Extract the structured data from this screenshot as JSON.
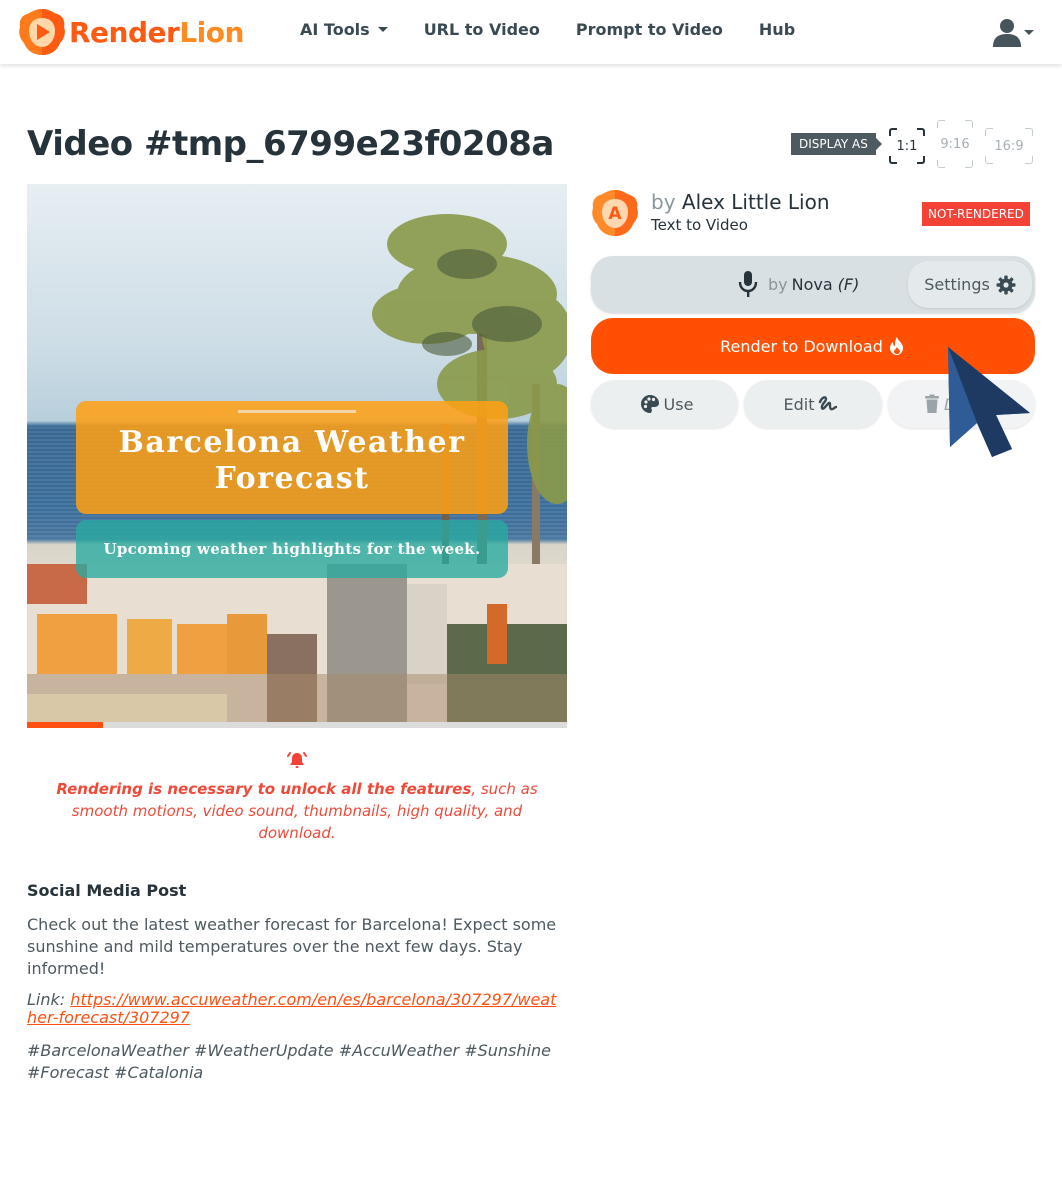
{
  "navbar": {
    "brand_part1": "Render",
    "brand_part2": "Lion",
    "items": [
      {
        "label": "AI Tools",
        "has_dropdown": true
      },
      {
        "label": "URL to Video"
      },
      {
        "label": "Prompt to Video"
      },
      {
        "label": "Hub"
      }
    ],
    "user_icon": "user-icon"
  },
  "page": {
    "title": "Video #tmp_6799e23f0208a",
    "display_as_label": "DISPLAY AS",
    "ratios": [
      {
        "label": "1:1",
        "active": true
      },
      {
        "label": "9:16",
        "active": false
      },
      {
        "label": "16:9",
        "active": false
      }
    ]
  },
  "video": {
    "title_text": "Barcelona Weather Forecast",
    "subtitle_text": "Upcoming weather highlights for the week.",
    "progress_percent": 14,
    "colors": {
      "title_card": "#ffa014",
      "subtitle_card": "#28aaa0",
      "progress": "#ff5012"
    }
  },
  "notice": {
    "icon": "bell-icon",
    "bold_text": "Rendering is necessary to unlock all the features",
    "rest_text": ", such as smooth motions, video sound, thumbnails, high quality, and download."
  },
  "post": {
    "heading": "Social Media Post",
    "body": "Check out the latest weather forecast for Barcelona! Expect some sunshine and mild temperatures over the next few days. Stay informed!",
    "link_label": "Link: ",
    "link_url": "https://www.accuweather.com/en/es/barcelona/307297/weather-forecast/307297",
    "hashtags": "#BarcelonaWeather #WeatherUpdate #AccuWeather #Sunshine #Forecast #Catalonia"
  },
  "sidebar": {
    "author_by": "by",
    "author_name": "Alex Little Lion",
    "author_initial": "A",
    "video_type": "Text to Video",
    "status": "NOT-RENDERED",
    "status_color": "#f44336",
    "voice_by": "by",
    "voice_name": "Nova",
    "voice_gender": "(F)",
    "settings_label": "Settings",
    "render_label": "Render to Download",
    "render_color": "#ff5003",
    "use_label": "Use",
    "edit_label": "Edit",
    "delete_label_visible": "D"
  }
}
